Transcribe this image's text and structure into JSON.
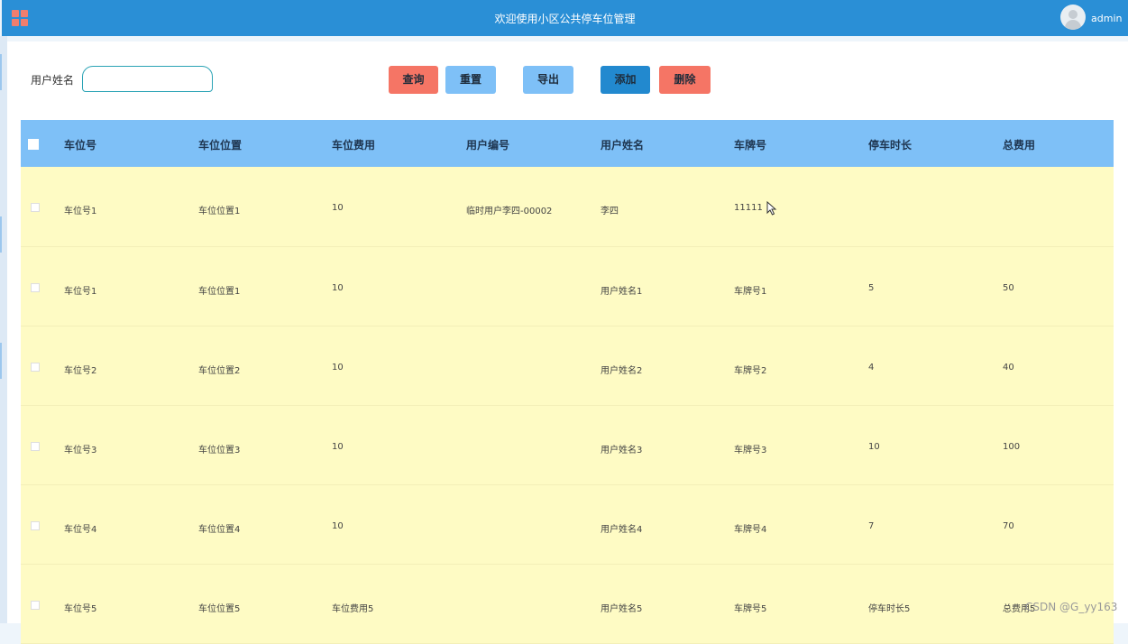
{
  "header": {
    "title": "欢迎使用小区公共停车位管理",
    "username": "admin"
  },
  "search": {
    "label": "用户姓名",
    "value": "",
    "placeholder": ""
  },
  "toolbar": {
    "query_label": "查询",
    "reset_label": "重置",
    "export_label": "导出",
    "add_label": "添加",
    "delete_label": "删除"
  },
  "table": {
    "columns": [
      "车位号",
      "车位位置",
      "车位费用",
      "用户编号",
      "用户姓名",
      "车牌号",
      "停车时长",
      "总费用"
    ],
    "rows": [
      [
        "车位号1",
        "车位位置1",
        "10",
        "临时用户李四-00002",
        "李四",
        "11111",
        "",
        ""
      ],
      [
        "车位号1",
        "车位位置1",
        "10",
        "",
        "用户姓名1",
        "车牌号1",
        "5",
        "50"
      ],
      [
        "车位号2",
        "车位位置2",
        "10",
        "",
        "用户姓名2",
        "车牌号2",
        "4",
        "40"
      ],
      [
        "车位号3",
        "车位位置3",
        "10",
        "",
        "用户姓名3",
        "车牌号3",
        "10",
        "100"
      ],
      [
        "车位号4",
        "车位位置4",
        "10",
        "",
        "用户姓名4",
        "车牌号4",
        "7",
        "70"
      ],
      [
        "车位号5",
        "车位位置5",
        "车位费用5",
        "",
        "用户姓名5",
        "车牌号5",
        "停车时长5",
        "总费用5"
      ]
    ]
  },
  "watermark": "CSDN @G_yy163",
  "colors": {
    "header_bg": "#2a8fd6",
    "table_header_bg": "#7ec0f7",
    "row_bg": "#fefbc4",
    "danger": "#f57565",
    "primary": "#2289cf",
    "light_primary": "#7ec0f7"
  },
  "icons": {
    "menu": "grid-menu-icon",
    "avatar": "user-avatar-icon",
    "cursor": "mouse-cursor-icon"
  }
}
